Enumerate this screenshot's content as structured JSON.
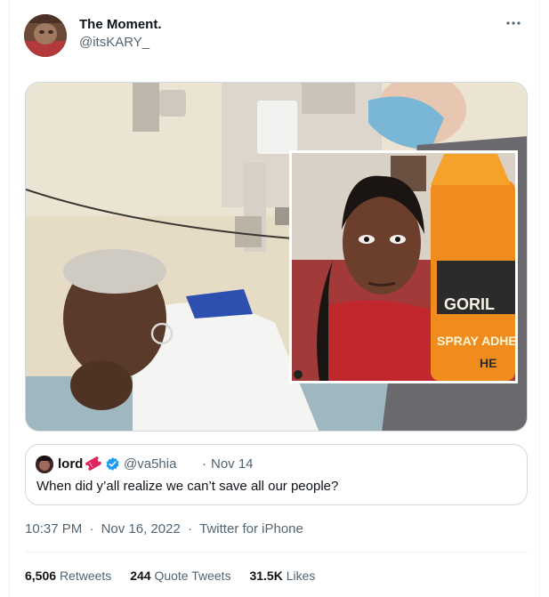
{
  "tweet": {
    "author_name": "The Moment.",
    "author_handle": "@itsKARY_",
    "more_icon": "more-horizontal-icon",
    "timestamp": "10:37 PM",
    "date": "Nov 16, 2022",
    "source": "Twitter for iPhone",
    "separator": "·"
  },
  "media": {
    "kind": "photo",
    "inset_label": "GORIL",
    "inset_label_2": "SPRAY ADHE",
    "inset_label_3": "HE"
  },
  "quoted": {
    "name": "lord",
    "emoji_icon": "ticket-emoji-icon",
    "verified_icon": "verified-badge-icon",
    "handle": "@va5hia",
    "separator": "·",
    "date": "Nov 14",
    "text": "When did y’all realize we can’t save all our people?"
  },
  "stats": [
    {
      "value": "6,506",
      "label": "Retweets"
    },
    {
      "value": "244",
      "label": "Quote Tweets"
    },
    {
      "value": "31.5K",
      "label": "Likes"
    }
  ],
  "colors": {
    "text": "#0f1419",
    "secondary": "#536471",
    "border": "#cfd9de",
    "verified": "#1d9bf0"
  }
}
